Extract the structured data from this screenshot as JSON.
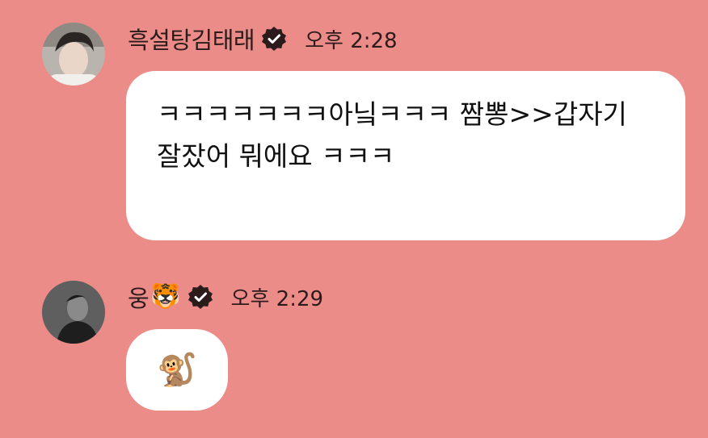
{
  "messages": [
    {
      "sender_name": "흑설탕김태래",
      "name_emoji": "",
      "verified": true,
      "time": "오후 2:28",
      "text": "ㅋㅋㅋㅋㅋㅋㅋ아닠ㅋㅋㅋ 짬뽕>>갑자기 잘잤어 뭐에요 ㅋㅋㅋ",
      "avatar_icon": "profile-photo-light"
    },
    {
      "sender_name": "웅",
      "name_emoji": "🐯",
      "verified": true,
      "time": "오후 2:29",
      "text": "🐒",
      "avatar_icon": "profile-photo-dark"
    }
  ],
  "colors": {
    "background": "#ec8c89",
    "bubble": "#ffffff",
    "text": "#111111",
    "verified_badge": "#2b1b1b"
  }
}
